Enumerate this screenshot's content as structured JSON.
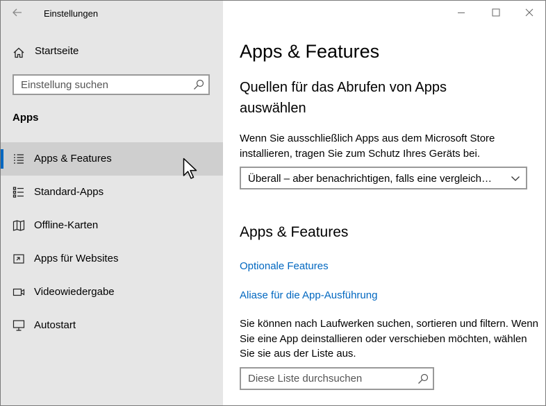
{
  "window": {
    "title": "Einstellungen",
    "controls": [
      "minimize",
      "maximize",
      "close"
    ]
  },
  "sidebar": {
    "home_label": "Startseite",
    "search_placeholder": "Einstellung suchen",
    "section_label": "Apps",
    "items": [
      {
        "label": "Apps & Features",
        "icon": "apps-features-icon",
        "active": true
      },
      {
        "label": "Standard-Apps",
        "icon": "default-apps-icon",
        "active": false
      },
      {
        "label": "Offline-Karten",
        "icon": "offline-maps-icon",
        "active": false
      },
      {
        "label": "Apps für Websites",
        "icon": "apps-for-websites-icon",
        "active": false
      },
      {
        "label": "Videowiedergabe",
        "icon": "video-playback-icon",
        "active": false
      },
      {
        "label": "Autostart",
        "icon": "startup-icon",
        "active": false
      }
    ]
  },
  "main": {
    "page_title": "Apps & Features",
    "sources_heading": "Quellen für das Abrufen von Apps auswählen",
    "sources_description": "Wenn Sie ausschließlich Apps aus dem Microsoft Store installieren, tragen Sie zum Schutz Ihres Geräts bei.",
    "sources_dropdown_value": "Überall – aber benachrichtigen, falls eine vergleich…",
    "apps_heading": "Apps & Features",
    "link_optional_features": "Optionale Features",
    "link_app_aliases": "Aliase für die App-Ausführung",
    "list_description": "Sie können nach Laufwerken suchen, sortieren und filtern. Wenn Sie eine App deinstallieren oder verschieben möchten, wählen Sie sie aus der Liste aus.",
    "list_search_placeholder": "Diese Liste durchsuchen"
  },
  "colors": {
    "sidebar_bg": "#e6e6e6",
    "active_item_bg": "#cfcfcf",
    "accent": "#0067c0",
    "link": "#0067c0"
  }
}
